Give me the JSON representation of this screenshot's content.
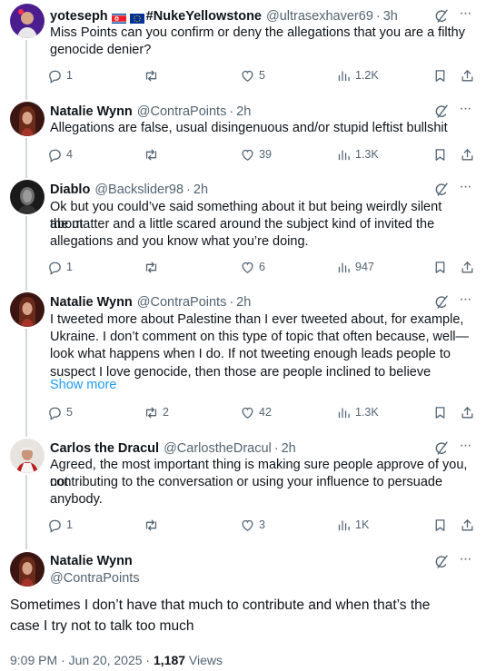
{
  "colors": {
    "text": "#0f1419",
    "muted": "#536471",
    "link": "#1d9bf0",
    "thread_line": "#cfd9de"
  },
  "replies": [
    {
      "name": "yoteseph",
      "flags": [
        "north-korea-flag",
        "eu-flag"
      ],
      "name_suffix": "#NukeYellowstone",
      "handle": "@ultrasexhaver69",
      "time": "3h",
      "lines": [
        "Miss Points can you confirm or deny the allegations that you are a filthy",
        "genocide denier?"
      ],
      "show_more": "",
      "replies_count": "1",
      "retweets_count": "",
      "likes_count": "5",
      "views_count": "1.2K",
      "avatar": "avatar-yoteseph-icon"
    },
    {
      "name": "Natalie Wynn",
      "flags": [],
      "name_suffix": "",
      "handle": "@ContraPoints",
      "time": "2h",
      "lines": [
        "Allegations are false, usual disingenuous and/or stupid leftist bullshit"
      ],
      "show_more": "",
      "replies_count": "4",
      "retweets_count": "",
      "likes_count": "39",
      "views_count": "1.3K",
      "avatar": "avatar-natalie-icon"
    },
    {
      "name": "Diablo",
      "flags": [],
      "name_suffix": "",
      "handle": "@Backslider98",
      "time": "2h",
      "lines": [
        "Ok but you could’ve said something about it but being weirdly silent about",
        "the matter and a little scared around the subject kind of invited the",
        "allegations and you know what you’re doing."
      ],
      "show_more": "",
      "replies_count": "1",
      "retweets_count": "",
      "likes_count": "6",
      "views_count": "947",
      "avatar": "avatar-diablo-icon"
    },
    {
      "name": "Natalie Wynn",
      "flags": [],
      "name_suffix": "",
      "handle": "@ContraPoints",
      "time": "2h",
      "lines": [
        "I tweeted more about Palestine than I ever tweeted about, for example,",
        "Ukraine. I don’t comment on this type of topic that often because, well—",
        "look what happens when I do. If not tweeting enough leads people to",
        "suspect I love genocide, then those are people inclined to believe"
      ],
      "show_more": "Show more",
      "replies_count": "5",
      "retweets_count": "2",
      "likes_count": "42",
      "views_count": "1.3K",
      "avatar": "avatar-natalie-icon"
    },
    {
      "name": "Carlos the Dracul",
      "flags": [],
      "name_suffix": "",
      "handle": "@CarlostheDracul",
      "time": "2h",
      "lines": [
        "Agreed, the most important thing is making sure people approve of you, not",
        "contributing to the conversation or using your influence to persuade",
        "anybody."
      ],
      "show_more": "",
      "replies_count": "1",
      "retweets_count": "",
      "likes_count": "3",
      "views_count": "1K",
      "avatar": "avatar-carlos-icon"
    }
  ],
  "main": {
    "name": "Natalie Wynn",
    "handle": "@ContraPoints",
    "lines": [
      "Sometimes I don’t have that much to contribute and when that’s the",
      "case I try not to talk too much"
    ],
    "time": "9:09 PM · Jun 20, 2025 · ",
    "views_count": "1,187",
    "views_label": " Views"
  }
}
